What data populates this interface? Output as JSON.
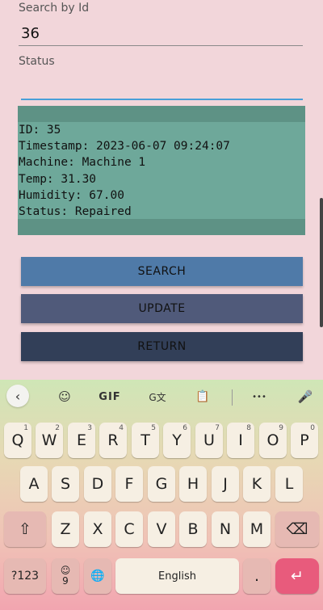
{
  "form": {
    "search_label": "Search by Id",
    "search_value": "36",
    "status_label": "Status",
    "status_value": ""
  },
  "record": {
    "lines": [
      "ID: 35",
      "Timestamp: 2023-06-07 09:24:07",
      "Machine: Machine 1",
      "Temp: 31.30",
      "Humidity: 67.00",
      "Status: Repaired"
    ]
  },
  "buttons": {
    "search": "SEARCH",
    "update": "UPDATE",
    "return": "RETURN"
  },
  "keyboard": {
    "toolbar": {
      "back": "‹",
      "sticker": "☺",
      "gif": "GIF",
      "translate": "G文",
      "clipboard": "📋",
      "more": "•••",
      "mic": "🎤"
    },
    "row1": [
      {
        "k": "Q",
        "h": "1"
      },
      {
        "k": "W",
        "h": "2"
      },
      {
        "k": "E",
        "h": "3"
      },
      {
        "k": "R",
        "h": "4"
      },
      {
        "k": "T",
        "h": "5"
      },
      {
        "k": "Y",
        "h": "6"
      },
      {
        "k": "U",
        "h": "7"
      },
      {
        "k": "I",
        "h": "8"
      },
      {
        "k": "O",
        "h": "9"
      },
      {
        "k": "P",
        "h": "0"
      }
    ],
    "row2": [
      "A",
      "S",
      "D",
      "F",
      "G",
      "H",
      "J",
      "K",
      "L"
    ],
    "row3": [
      "Z",
      "X",
      "C",
      "V",
      "B",
      "N",
      "M"
    ],
    "shift": "⇧",
    "backspace": "⌫",
    "symbols": "?123",
    "emoji_top": "☺",
    "emoji_bottom": "9",
    "globe": "🌐",
    "space": "English",
    "period": ".",
    "enter": "↵"
  },
  "colors": {
    "background": "#f2d6da",
    "info_box": "#6ea89a",
    "search_button": "#4f7aa8",
    "update_button": "#505a7a",
    "return_button": "#323f58",
    "enter_key": "#e85b7c"
  }
}
